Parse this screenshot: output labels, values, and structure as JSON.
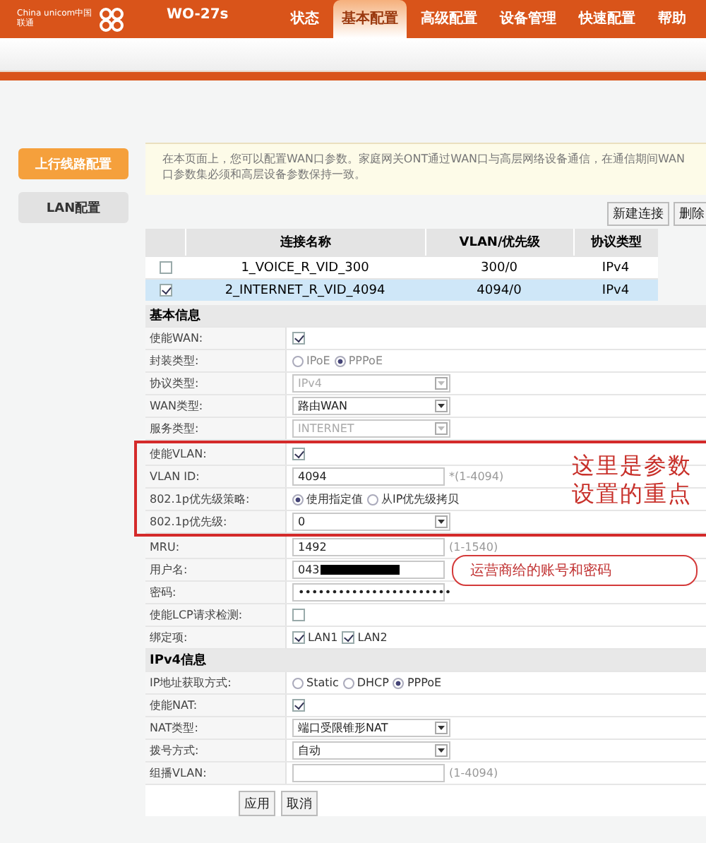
{
  "header": {
    "logo_text": "China unicom中国联通",
    "model": "WO-27s",
    "tabs": [
      {
        "label": "状态",
        "selected": false
      },
      {
        "label": "基本配置",
        "selected": true
      },
      {
        "label": "高级配置",
        "selected": false
      },
      {
        "label": "设备管理",
        "selected": false
      },
      {
        "label": "快速配置",
        "selected": false
      },
      {
        "label": "帮助",
        "selected": false
      }
    ]
  },
  "sidebar": {
    "items": [
      {
        "label": "上行线路配置",
        "selected": true
      },
      {
        "label": "LAN配置",
        "selected": false
      }
    ]
  },
  "notice": "在本页面上，您可以配置WAN口参数。家庭网关ONT通过WAN口与高层网络设备通信，在通信期间WAN口参数集必须和高层设备参数保持一致。",
  "table_buttons": [
    "新建连接",
    "删除"
  ],
  "table": {
    "columns": [
      "连接名称",
      "VLAN/优先级",
      "协议类型"
    ],
    "rows": [
      {
        "checked": false,
        "selected": false,
        "cells": [
          "1_VOICE_R_VID_300",
          "300/0",
          "IPv4"
        ]
      },
      {
        "checked": true,
        "selected": true,
        "cells": [
          "2_INTERNET_R_VID_4094",
          "4094/0",
          "IPv4"
        ]
      }
    ]
  },
  "form": [
    {
      "kind": "section",
      "title": "基本信息"
    },
    {
      "kind": "checkbox",
      "label": "使能WAN:",
      "checked": true
    },
    {
      "kind": "radio",
      "label": "封装类型:",
      "disabled": true,
      "options": [
        {
          "label": "IPoE",
          "selected": false
        },
        {
          "label": "PPPoE",
          "selected": true
        }
      ]
    },
    {
      "kind": "select",
      "label": "协议类型:",
      "value": "IPv4",
      "disabled": true
    },
    {
      "kind": "select",
      "label": "WAN类型:",
      "value": "路由WAN",
      "disabled": false
    },
    {
      "kind": "select",
      "label": "服务类型:",
      "value": "INTERNET",
      "disabled": true
    },
    {
      "kind": "group",
      "note": "这里是参数设置的重点",
      "rows": [
        {
          "kind": "checkbox",
          "label": "使能VLAN:",
          "checked": true
        },
        {
          "kind": "input",
          "label": "VLAN ID:",
          "value": "4094",
          "hint": "*(1-4094)"
        },
        {
          "kind": "radio",
          "label": "802.1p优先级策略:",
          "disabled": false,
          "options": [
            {
              "label": "使用指定值",
              "selected": true
            },
            {
              "label": "从IP优先级拷贝",
              "selected": false
            }
          ]
        },
        {
          "kind": "select",
          "label": "802.1p优先级:",
          "value": "0",
          "disabled": false
        }
      ]
    },
    {
      "kind": "input",
      "label": "MRU:",
      "value": "1492",
      "hint": "(1-1540)"
    },
    {
      "kind": "input",
      "label": "用户名:",
      "value": "043",
      "redacted": true,
      "callout": "运营商给的账号和密码"
    },
    {
      "kind": "input",
      "label": "密码:",
      "value": "•••••••••••••••••••••••"
    },
    {
      "kind": "checkbox",
      "label": "使能LCP请求检测:",
      "checked": false
    },
    {
      "kind": "checks",
      "label": "绑定项:",
      "options": [
        {
          "label": "LAN1",
          "checked": true
        },
        {
          "label": "LAN2",
          "checked": true
        }
      ]
    },
    {
      "kind": "section",
      "title": "IPv4信息"
    },
    {
      "kind": "radio",
      "label": "IP地址获取方式:",
      "disabled": false,
      "options": [
        {
          "label": "Static",
          "selected": false
        },
        {
          "label": "DHCP",
          "selected": false
        },
        {
          "label": "PPPoE",
          "selected": true
        }
      ]
    },
    {
      "kind": "checkbox",
      "label": "使能NAT:",
      "checked": true
    },
    {
      "kind": "select",
      "label": "NAT类型:",
      "value": "端口受限锥形NAT",
      "disabled": false
    },
    {
      "kind": "select",
      "label": "拨号方式:",
      "value": "自动",
      "disabled": false
    },
    {
      "kind": "input",
      "label": "组播VLAN:",
      "hint": "(1-4094)"
    }
  ],
  "form_buttons": [
    "应用",
    "取消"
  ]
}
